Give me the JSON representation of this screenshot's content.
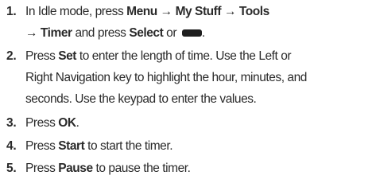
{
  "steps": [
    {
      "number": "1.",
      "line1": {
        "t1": "In Idle mode, press ",
        "b1": "Menu",
        "a1": " → ",
        "b2": "My Stuff",
        "a2": " → ",
        "b3": "Tools"
      },
      "line2": {
        "a1": "→ ",
        "b1": "Timer",
        "t1": " and press ",
        "b2": "Select",
        "t2": " or ",
        "t3": "."
      },
      "key_icon": "soft-key-icon"
    },
    {
      "number": "2.",
      "line1": {
        "t1": "Press ",
        "b1": "Set",
        "t2": " to enter the length of time. Use the Left or"
      },
      "line2": "Right Navigation key to highlight the hour, minutes, and",
      "line3": "seconds. Use the keypad to enter the values."
    },
    {
      "number": "3.",
      "t1": "Press ",
      "b1": "OK",
      "t2": "."
    },
    {
      "number": "4.",
      "t1": "Press ",
      "b1": "Start",
      "t2": " to start the timer."
    },
    {
      "number": "5.",
      "t1": "Press ",
      "b1": "Pause",
      "t2": " to pause the timer."
    }
  ]
}
